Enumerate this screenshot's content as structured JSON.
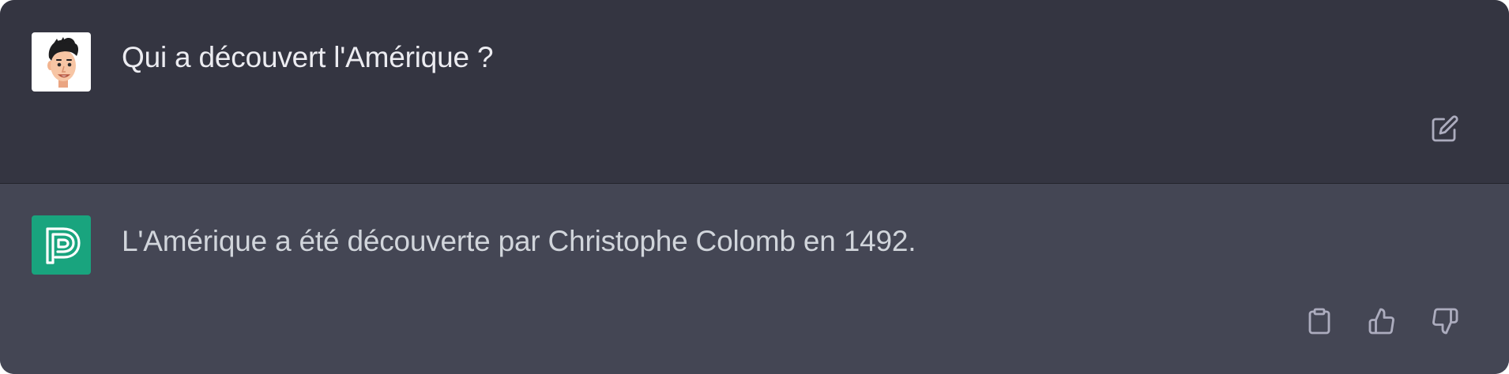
{
  "conversation": {
    "user_message": {
      "avatar_icon": "user-avatar-icon",
      "text": "Qui a découvert l'Amérique ?",
      "actions": [
        {
          "name": "edit-button",
          "icon": "edit-icon"
        }
      ]
    },
    "assistant_message": {
      "avatar_icon": "assistant-logo-icon",
      "avatar_color": "#19a47e",
      "text": "L'Amérique a été découverte par Christophe Colomb en 1492.",
      "actions": [
        {
          "name": "copy-button",
          "icon": "clipboard-icon"
        },
        {
          "name": "thumbs-up-button",
          "icon": "thumbs-up-icon"
        },
        {
          "name": "thumbs-down-button",
          "icon": "thumbs-down-icon"
        }
      ]
    }
  },
  "colors": {
    "user_row_bg": "#343541",
    "assistant_row_bg": "#444654",
    "user_text": "#ececf1",
    "assistant_text": "#d1d5db",
    "icon_color": "#acacbe"
  }
}
